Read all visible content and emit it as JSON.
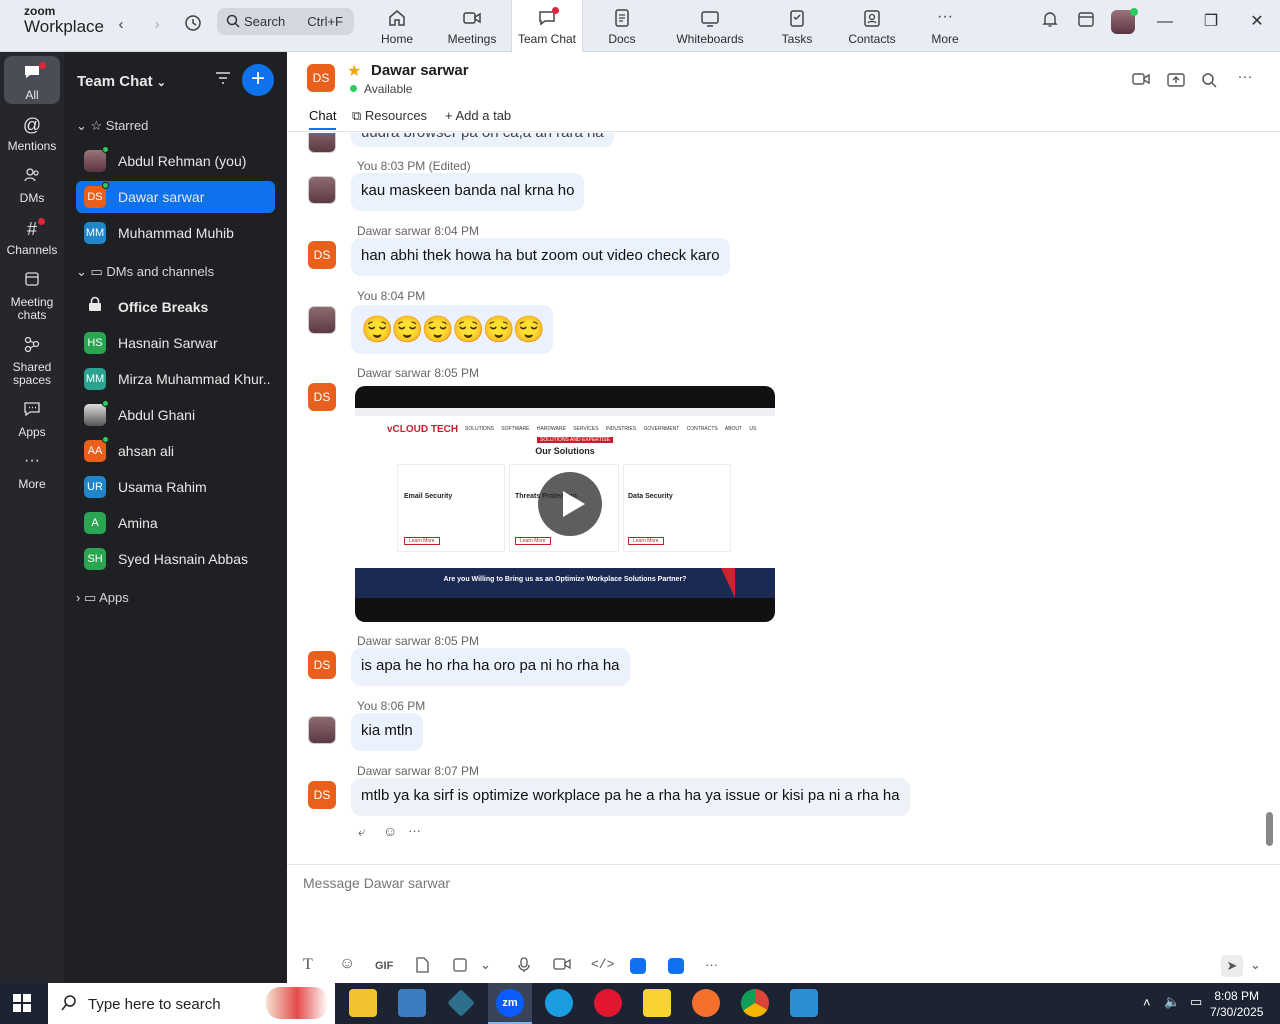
{
  "app": {
    "brand_line1": "zoom",
    "brand_line2": "Workplace"
  },
  "search": {
    "placeholder": "Search",
    "shortcut": "Ctrl+F"
  },
  "top_tabs": [
    "Home",
    "Meetings",
    "Team Chat",
    "Docs",
    "Whiteboards",
    "Tasks",
    "Contacts",
    "More"
  ],
  "rail": [
    "All",
    "Mentions",
    "DMs",
    "Channels",
    "Meeting chats",
    "Shared spaces",
    "Apps",
    "More"
  ],
  "sidebar": {
    "title": "Team Chat",
    "starred_label": "Starred",
    "starred": [
      {
        "name": "Abdul Rehman (you)",
        "initials": ""
      },
      {
        "name": "Dawar sarwar",
        "initials": "DS"
      },
      {
        "name": "Muhammad Muhib",
        "initials": "MM"
      }
    ],
    "dms_label": "DMs and channels",
    "dms": [
      {
        "name": "Office Breaks",
        "initials": ""
      },
      {
        "name": "Hasnain Sarwar",
        "initials": "HS"
      },
      {
        "name": "Mirza Muhammad Khur...",
        "initials": "MM"
      },
      {
        "name": "Abdul Ghani",
        "initials": ""
      },
      {
        "name": "ahsan ali",
        "initials": "AA"
      },
      {
        "name": "Usama Rahim",
        "initials": "UR"
      },
      {
        "name": "Amina",
        "initials": "A"
      },
      {
        "name": "Syed Hasnain Abbas",
        "initials": "SH"
      }
    ],
    "apps_label": "Apps"
  },
  "chat": {
    "contact": "Dawar sarwar",
    "initials": "DS",
    "status": "Available",
    "tabs": [
      "Chat",
      "Resources",
      "Add a tab"
    ],
    "partial_message": "uudra browser pa on ca,a an rara ha",
    "messages": [
      {
        "meta": "You 8:03 PM (Edited)",
        "text": "kau maskeen banda nal krna ho"
      },
      {
        "meta": "Dawar sarwar 8:04 PM",
        "text": "han abhi thek howa ha but zoom out video check karo"
      },
      {
        "meta": "You 8:04 PM",
        "text": "😌😌😌😌😌😌"
      },
      {
        "meta": "Dawar sarwar 8:05 PM",
        "text": ""
      },
      {
        "meta": "Dawar sarwar 8:05 PM",
        "text": "is apa he ho rha ha oro pa ni ho rha ha"
      },
      {
        "meta": "You 8:06 PM",
        "text": "kia mtln"
      },
      {
        "meta": "Dawar sarwar 8:07 PM",
        "text": "mtlb ya ka sirf is optimize workplace pa he a rha ha ya issue or kisi pa ni a rha ha"
      }
    ],
    "video": {
      "site_logo": "vCLOUD TECH",
      "heading": "Our Solutions",
      "badge": "SOLUTIONS AND EXPERTISE",
      "nav": [
        "SOLUTIONS",
        "SOFTWARE",
        "HARDWARE",
        "SERVICES",
        "INDUSTRIES",
        "GOVERNMENT CONTRACTS",
        "ABOUT US"
      ],
      "cards": [
        "Email Security",
        "Threats Protection",
        "Data Security"
      ],
      "learn_more": "Learn More",
      "banner": "Are you Willing to Bring us as an Optimize Workplace Solutions Partner?"
    },
    "compose_placeholder": "Message Dawar sarwar",
    "gif_label": "GIF"
  },
  "taskbar": {
    "search_placeholder": "Type here to search",
    "time": "8:08 PM",
    "date": "7/30/2025"
  },
  "colors": {
    "accent": "#0e72ed",
    "ds_avatar": "#e8601c",
    "rail": "#25272d",
    "sidebar": "#1f2023"
  }
}
